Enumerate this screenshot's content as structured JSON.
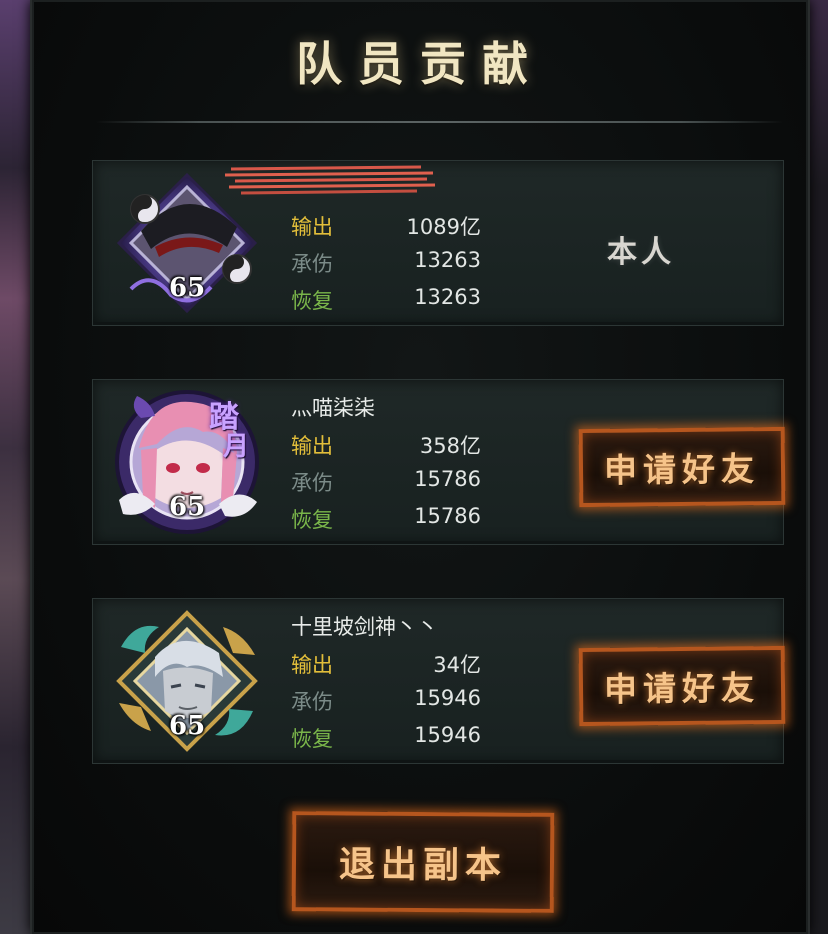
{
  "title": "队员贡献",
  "labels": {
    "output": "输出",
    "tank": "承伤",
    "heal": "恢复"
  },
  "members": [
    {
      "name": "",
      "name_obscured": true,
      "level": "65",
      "output": "1089亿",
      "tank": "13263",
      "heal": "13263",
      "action": "本人",
      "action_is_button": false
    },
    {
      "name": "灬喵柒柒",
      "level": "65",
      "badge": [
        "踏",
        "月"
      ],
      "output": "358亿",
      "tank": "15786",
      "heal": "15786",
      "action": "申请好友",
      "action_is_button": true
    },
    {
      "name": "十里坡剑神丶丶",
      "level": "65",
      "output": "34亿",
      "tank": "15946",
      "heal": "15946",
      "action": "申请好友",
      "action_is_button": true
    }
  ],
  "exit_button": "退出副本",
  "colors": {
    "title": "#f1e6c2",
    "output_label": "#e2be3a",
    "tank_label": "#7b8b88",
    "heal_label": "#7ab64a",
    "button_glow": "#ff7a1e"
  },
  "icons": {
    "avatar_1": "masked-bamboo-hat-avatar-with-yin-yang-frame",
    "avatar_2": "pink-haired-girl-avatar-with-purple-frame",
    "avatar_3": "white-haired-swordsman-avatar-with-jade-frame"
  }
}
